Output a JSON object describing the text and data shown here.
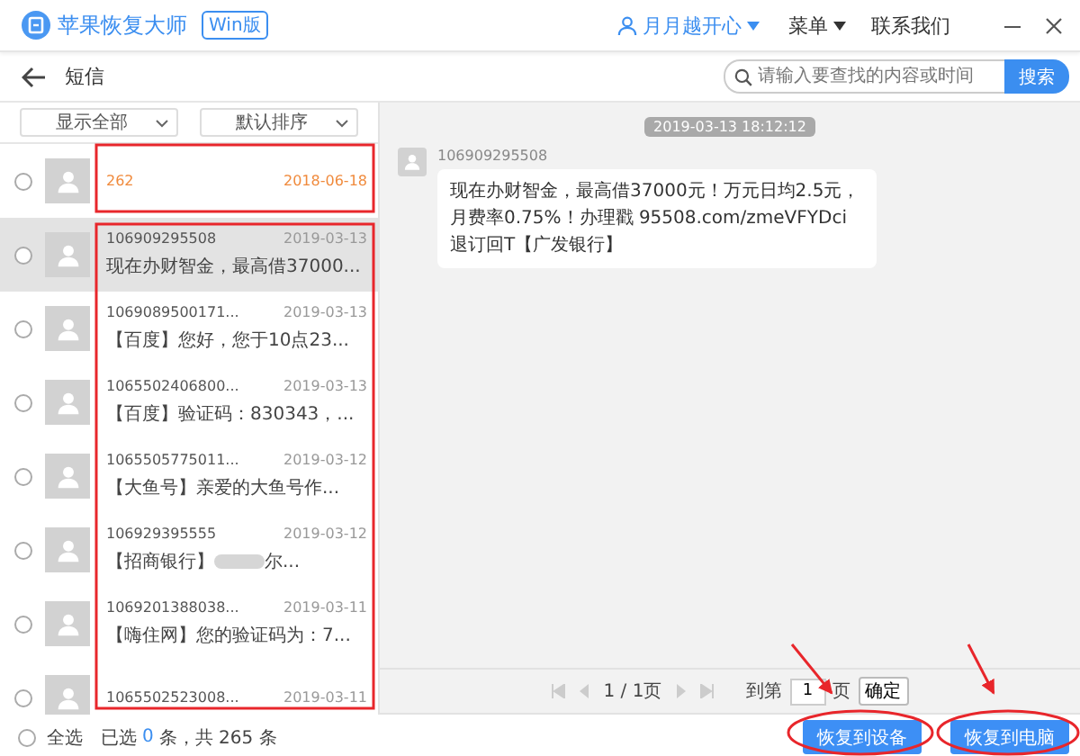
{
  "window": {
    "app_name": "苹果恢复大师",
    "edition_badge": "Win版",
    "user": "月月越开心",
    "menu": "菜单",
    "contact": "联系我们"
  },
  "toolbar": {
    "title": "短信",
    "search": {
      "placeholder": "请输入要查找的内容或时间"
    },
    "search_button": "搜索"
  },
  "filters": [
    {
      "label": "显示全部"
    },
    {
      "label": "默认排序"
    }
  ],
  "conversations": [
    {
      "sender": "262",
      "date": "2018-06-18",
      "highlighted": true,
      "selected": false,
      "checked": false,
      "redacted": false
    },
    {
      "sender": "106909295508",
      "date": "2019-03-13",
      "preview": "现在办财智金，最高借37000...",
      "highlighted": false,
      "selected": true,
      "checked": false,
      "redacted": false
    },
    {
      "sender": "1069089500171...",
      "date": "2019-03-13",
      "preview": "【百度】您好，您于10点23...",
      "highlighted": false,
      "selected": false,
      "checked": false,
      "redacted": false
    },
    {
      "sender": "1065502406800...",
      "date": "2019-03-13",
      "preview": "【百度】验证码：830343，...",
      "highlighted": false,
      "selected": false,
      "checked": false,
      "redacted": false
    },
    {
      "sender": "1065505775011...",
      "date": "2019-03-12",
      "preview": "【大鱼号】亲爱的大鱼号作...",
      "highlighted": false,
      "selected": false,
      "checked": false,
      "redacted": false
    },
    {
      "sender": "106929395555",
      "date": "2019-03-12",
      "preview": "【招商银行】",
      "preview_tail": "尔...",
      "highlighted": false,
      "selected": false,
      "checked": false,
      "redacted": true
    },
    {
      "sender": "1069201388038...",
      "date": "2019-03-11",
      "preview": "【嗨住网】您的验证码为：7...",
      "highlighted": false,
      "selected": false,
      "checked": false,
      "redacted": false
    },
    {
      "sender": "1065502523008...",
      "date": "2019-03-11",
      "highlighted": false,
      "selected": false,
      "checked": false,
      "redacted": false
    }
  ],
  "thread": {
    "timestamp": "2019-03-13 18:12:12",
    "messages": [
      {
        "sender": "106909295508",
        "text": "现在办财智金，最高借37000元！万元日均2.5元，月费率0.75%！办理戳 95508.com/zmeVFYDci 退订回T【广发银行】"
      }
    ]
  },
  "pagination": {
    "page": "1 / 1页",
    "goto_label": "到第",
    "goto_value": "1",
    "goto_unit": "页",
    "confirm": "确定"
  },
  "footer": {
    "select_all": {
      "label": "全选",
      "checked": false
    },
    "selected_prefix": "已选",
    "selected_count": "0",
    "selected_suffix": "条，共 265 条",
    "buttons": [
      "恢复到设备",
      "恢复到电脑"
    ]
  }
}
